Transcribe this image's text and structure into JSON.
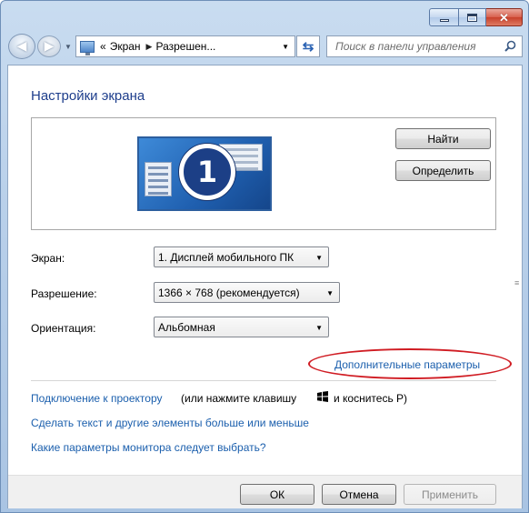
{
  "address_bar": {
    "chevron": "«",
    "crumbs": [
      "Экран",
      "Разрешен..."
    ]
  },
  "search": {
    "placeholder": "Поиск в панели управления"
  },
  "page": {
    "title": "Настройки экрана",
    "monitor_number": "1",
    "buttons": {
      "find": "Найти",
      "identify": "Определить"
    }
  },
  "settings": {
    "display_label": "Экран:",
    "display_value": "1. Дисплей мобильного ПК",
    "resolution_label": "Разрешение:",
    "resolution_value": "1366 × 768 (рекомендуется)",
    "orientation_label": "Ориентация:",
    "orientation_value": "Альбомная"
  },
  "links": {
    "advanced": "Дополнительные параметры",
    "projector": "Подключение к проектору",
    "projector_hint_before": "(или нажмите клавишу",
    "projector_hint_after": "и коснитесь P)",
    "text_size": "Сделать текст и другие элементы больше или меньше",
    "which_settings": "Какие параметры монитора следует выбрать?"
  },
  "footer": {
    "ok": "ОК",
    "cancel": "Отмена",
    "apply": "Применить"
  },
  "colors": {
    "title": "#1e3e8c",
    "link": "#1b5fad",
    "highlight_oval": "#d01c23"
  }
}
